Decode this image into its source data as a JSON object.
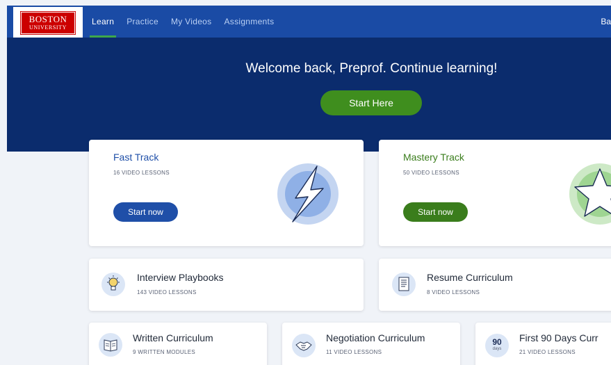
{
  "logo": {
    "line1": "BOSTON",
    "line2": "UNIVERSITY"
  },
  "nav": {
    "items": [
      {
        "label": "Learn",
        "active": true
      },
      {
        "label": "Practice",
        "active": false
      },
      {
        "label": "My Videos",
        "active": false
      },
      {
        "label": "Assignments",
        "active": false
      }
    ],
    "right_label": "Ba"
  },
  "hero": {
    "title": "Welcome back, Preprof. Continue learning!",
    "button": "Start Here"
  },
  "tracks": [
    {
      "title": "Fast Track",
      "subtitle": "16 VIDEO LESSONS",
      "button": "Start now",
      "accent": "#1f4fa8",
      "icon": "lightning-icon"
    },
    {
      "title": "Mastery Track",
      "subtitle": "50 VIDEO LESSONS",
      "button": "Start now",
      "accent": "#3a7d1c",
      "icon": "star-icon"
    }
  ],
  "curricula": [
    {
      "title": "Interview Playbooks",
      "subtitle": "143 VIDEO LESSONS",
      "icon": "lightbulb-icon"
    },
    {
      "title": "Resume Curriculum",
      "subtitle": "8 VIDEO LESSONS",
      "icon": "document-icon"
    },
    {
      "title": "Written Curriculum",
      "subtitle": "9 WRITTEN MODULES",
      "icon": "book-icon"
    },
    {
      "title": "Negotiation Curriculum",
      "subtitle": "11 VIDEO LESSONS",
      "icon": "handshake-icon"
    },
    {
      "title": "First 90 Days Curr",
      "subtitle": "21 VIDEO LESSONS",
      "icon": "ninety-days-icon",
      "icon_number": "90",
      "icon_unit": "days"
    }
  ],
  "colors": {
    "topbar": "#1a4ba5",
    "hero": "#0b2c6d",
    "green": "#3f8e1e",
    "page_bg": "#f0f3f8"
  }
}
